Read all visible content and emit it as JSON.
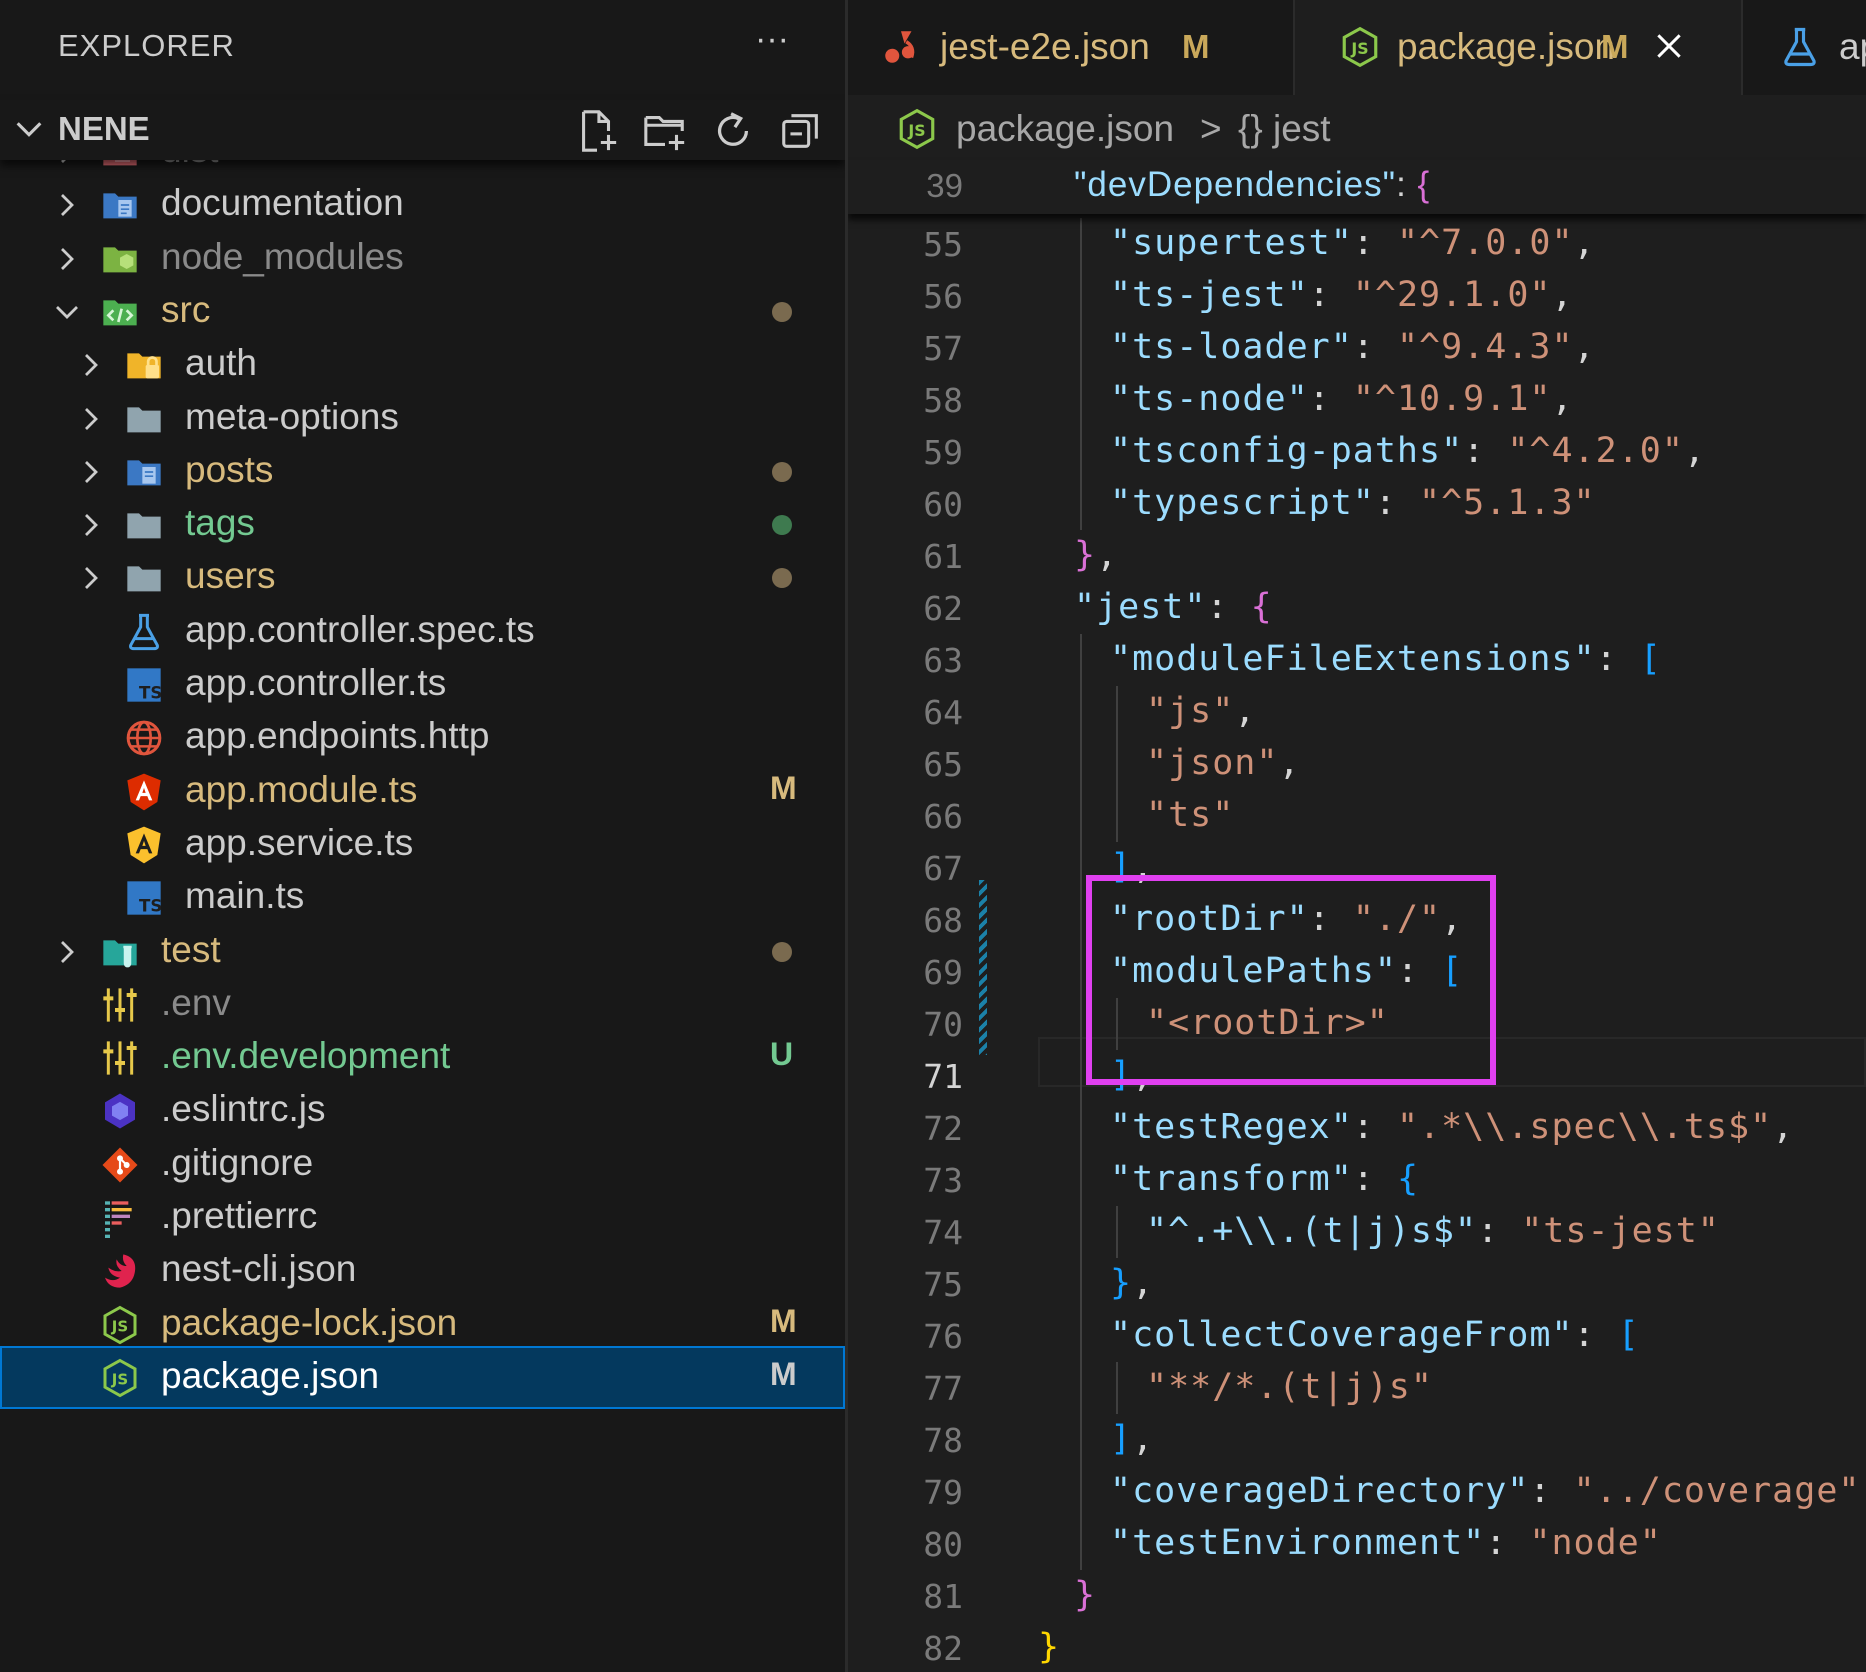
{
  "explorer": {
    "title": "EXPLORER",
    "more_label": "···",
    "section": "NENE",
    "items": [
      {
        "name": "dist",
        "color": "#8a8a8a",
        "icon": "dist-folder-icon",
        "chevron": "right"
      },
      {
        "name": "documentation",
        "color": "#cccccc",
        "icon": "docs-folder-icon",
        "chevron": "right"
      },
      {
        "name": "node_modules",
        "color": "#8a8a8a",
        "icon": "node-folder-icon",
        "chevron": "right"
      },
      {
        "name": "src",
        "color": "#d7ba7d",
        "icon": "src-folder-icon",
        "chevron": "down",
        "dot": "#7a6a4f"
      },
      {
        "name": "auth",
        "color": "#cccccc",
        "icon": "lock-folder-icon",
        "chevron": "right"
      },
      {
        "name": "meta-options",
        "color": "#cccccc",
        "icon": "folder-icon",
        "chevron": "right"
      },
      {
        "name": "posts",
        "color": "#d7ba7d",
        "icon": "posts-folder-icon",
        "chevron": "right",
        "dot": "#7a6a4f"
      },
      {
        "name": "tags",
        "color": "#73c991",
        "icon": "folder-icon",
        "chevron": "right",
        "dot": "#3e7a4f"
      },
      {
        "name": "users",
        "color": "#d7ba7d",
        "icon": "folder-icon",
        "chevron": "right",
        "dot": "#7a6a4f"
      },
      {
        "name": "app.controller.spec.ts",
        "color": "#cccccc",
        "icon": "flask-icon"
      },
      {
        "name": "app.controller.ts",
        "color": "#cccccc",
        "icon": "typescript-icon"
      },
      {
        "name": "app.endpoints.http",
        "color": "#cccccc",
        "icon": "globe-icon"
      },
      {
        "name": "app.module.ts",
        "color": "#d7ba7d",
        "icon": "angular-red-icon",
        "badge": "M",
        "badge_color": "#d7ba7d"
      },
      {
        "name": "app.service.ts",
        "color": "#cccccc",
        "icon": "angular-yellow-icon"
      },
      {
        "name": "main.ts",
        "color": "#cccccc",
        "icon": "typescript-icon"
      },
      {
        "name": "test",
        "color": "#d7ba7d",
        "icon": "test-folder-icon",
        "chevron": "right",
        "dot": "#7a6a4f"
      },
      {
        "name": ".env",
        "color": "#8a8a8a",
        "icon": "sliders-icon"
      },
      {
        "name": ".env.development",
        "color": "#73c991",
        "icon": "sliders-icon",
        "badge": "U",
        "badge_color": "#73c991"
      },
      {
        "name": ".eslintrc.js",
        "color": "#cccccc",
        "icon": "eslint-icon"
      },
      {
        "name": ".gitignore",
        "color": "#cccccc",
        "icon": "git-icon"
      },
      {
        "name": ".prettierrc",
        "color": "#cccccc",
        "icon": "prettier-icon"
      },
      {
        "name": "nest-cli.json",
        "color": "#cccccc",
        "icon": "nest-icon"
      },
      {
        "name": "package-lock.json",
        "color": "#d7ba7d",
        "icon": "nodejs-icon",
        "badge": "M",
        "badge_color": "#d7ba7d"
      },
      {
        "name": "package.json",
        "color": "#ffffff",
        "icon": "nodejs-icon",
        "badge": "M",
        "badge_color": "#cccccc",
        "selected": true
      }
    ]
  },
  "tabs": [
    {
      "label": "jest-e2e.json",
      "mod": "M",
      "icon": "jest-icon"
    },
    {
      "label": "package.json",
      "mod": "M",
      "icon": "nodejs-icon",
      "active": true
    },
    {
      "label": "ap",
      "icon": "flask-icon"
    }
  ],
  "breadcrumb": {
    "file": "package.json",
    "sep": ">",
    "symbol": "{} jest"
  },
  "editor": {
    "sticky": {
      "num": "39",
      "indent": 1,
      "tokens": [
        [
          "k",
          "\"devDependencies\""
        ],
        [
          "p",
          ": "
        ],
        [
          "b2",
          "{"
        ]
      ]
    },
    "lines": [
      {
        "num": "55",
        "indent": 2,
        "tokens": [
          [
            "k",
            "\"supertest\""
          ],
          [
            "p",
            ": "
          ],
          [
            "s",
            "\"^7.0.0\""
          ],
          [
            "p",
            ","
          ]
        ]
      },
      {
        "num": "56",
        "indent": 2,
        "tokens": [
          [
            "k",
            "\"ts-jest\""
          ],
          [
            "p",
            ": "
          ],
          [
            "s",
            "\"^29.1.0\""
          ],
          [
            "p",
            ","
          ]
        ]
      },
      {
        "num": "57",
        "indent": 2,
        "tokens": [
          [
            "k",
            "\"ts-loader\""
          ],
          [
            "p",
            ": "
          ],
          [
            "s",
            "\"^9.4.3\""
          ],
          [
            "p",
            ","
          ]
        ]
      },
      {
        "num": "58",
        "indent": 2,
        "tokens": [
          [
            "k",
            "\"ts-node\""
          ],
          [
            "p",
            ": "
          ],
          [
            "s",
            "\"^10.9.1\""
          ],
          [
            "p",
            ","
          ]
        ]
      },
      {
        "num": "59",
        "indent": 2,
        "tokens": [
          [
            "k",
            "\"tsconfig-paths\""
          ],
          [
            "p",
            ": "
          ],
          [
            "s",
            "\"^4.2.0\""
          ],
          [
            "p",
            ","
          ]
        ]
      },
      {
        "num": "60",
        "indent": 2,
        "tokens": [
          [
            "k",
            "\"typescript\""
          ],
          [
            "p",
            ": "
          ],
          [
            "s",
            "\"^5.1.3\""
          ]
        ]
      },
      {
        "num": "61",
        "indent": 1,
        "tokens": [
          [
            "b2",
            "}"
          ],
          [
            "p",
            ","
          ]
        ]
      },
      {
        "num": "62",
        "indent": 1,
        "tokens": [
          [
            "k",
            "\"jest\""
          ],
          [
            "p",
            ": "
          ],
          [
            "b2",
            "{"
          ]
        ]
      },
      {
        "num": "63",
        "indent": 2,
        "tokens": [
          [
            "k",
            "\"moduleFileExtensions\""
          ],
          [
            "p",
            ": "
          ],
          [
            "b3",
            "["
          ]
        ]
      },
      {
        "num": "64",
        "indent": 3,
        "tokens": [
          [
            "s",
            "\"js\""
          ],
          [
            "p",
            ","
          ]
        ]
      },
      {
        "num": "65",
        "indent": 3,
        "tokens": [
          [
            "s",
            "\"json\""
          ],
          [
            "p",
            ","
          ]
        ]
      },
      {
        "num": "66",
        "indent": 3,
        "tokens": [
          [
            "s",
            "\"ts\""
          ]
        ]
      },
      {
        "num": "67",
        "indent": 2,
        "tokens": [
          [
            "b3",
            "]"
          ],
          [
            "p",
            ","
          ]
        ]
      },
      {
        "num": "68",
        "indent": 2,
        "tokens": [
          [
            "k",
            "\"rootDir\""
          ],
          [
            "p",
            ": "
          ],
          [
            "s",
            "\"./\""
          ],
          [
            "p",
            ","
          ]
        ]
      },
      {
        "num": "69",
        "indent": 2,
        "tokens": [
          [
            "k",
            "\"modulePaths\""
          ],
          [
            "p",
            ": "
          ],
          [
            "b3",
            "["
          ]
        ]
      },
      {
        "num": "70",
        "indent": 3,
        "tokens": [
          [
            "s",
            "\"<rootDir>\""
          ]
        ]
      },
      {
        "num": "71",
        "indent": 2,
        "current": true,
        "tokens": [
          [
            "b3",
            "]"
          ],
          [
            "p",
            ","
          ]
        ]
      },
      {
        "num": "72",
        "indent": 2,
        "tokens": [
          [
            "k",
            "\"testRegex\""
          ],
          [
            "p",
            ": "
          ],
          [
            "s",
            "\".*\\\\.spec\\\\.ts$\""
          ],
          [
            "p",
            ","
          ]
        ]
      },
      {
        "num": "73",
        "indent": 2,
        "tokens": [
          [
            "k",
            "\"transform\""
          ],
          [
            "p",
            ": "
          ],
          [
            "b3",
            "{"
          ]
        ]
      },
      {
        "num": "74",
        "indent": 3,
        "tokens": [
          [
            "k",
            "\"^.+\\\\.(t|j)s$\""
          ],
          [
            "p",
            ": "
          ],
          [
            "s",
            "\"ts-jest\""
          ]
        ]
      },
      {
        "num": "75",
        "indent": 2,
        "tokens": [
          [
            "b3",
            "}"
          ],
          [
            "p",
            ","
          ]
        ]
      },
      {
        "num": "76",
        "indent": 2,
        "tokens": [
          [
            "k",
            "\"collectCoverageFrom\""
          ],
          [
            "p",
            ": "
          ],
          [
            "b3",
            "["
          ]
        ]
      },
      {
        "num": "77",
        "indent": 3,
        "tokens": [
          [
            "s",
            "\"**/*.(t|j)s\""
          ]
        ]
      },
      {
        "num": "78",
        "indent": 2,
        "tokens": [
          [
            "b3",
            "]"
          ],
          [
            "p",
            ","
          ]
        ]
      },
      {
        "num": "79",
        "indent": 2,
        "tokens": [
          [
            "k",
            "\"coverageDirectory\""
          ],
          [
            "p",
            ": "
          ],
          [
            "s",
            "\"../coverage\""
          ],
          [
            "p",
            ","
          ]
        ]
      },
      {
        "num": "80",
        "indent": 2,
        "tokens": [
          [
            "k",
            "\"testEnvironment\""
          ],
          [
            "p",
            ": "
          ],
          [
            "s",
            "\"node\""
          ]
        ]
      },
      {
        "num": "81",
        "indent": 1,
        "tokens": [
          [
            "b2",
            "}"
          ]
        ]
      },
      {
        "num": "82",
        "indent": 0,
        "tokens": [
          [
            "b1",
            "}"
          ]
        ]
      }
    ]
  }
}
